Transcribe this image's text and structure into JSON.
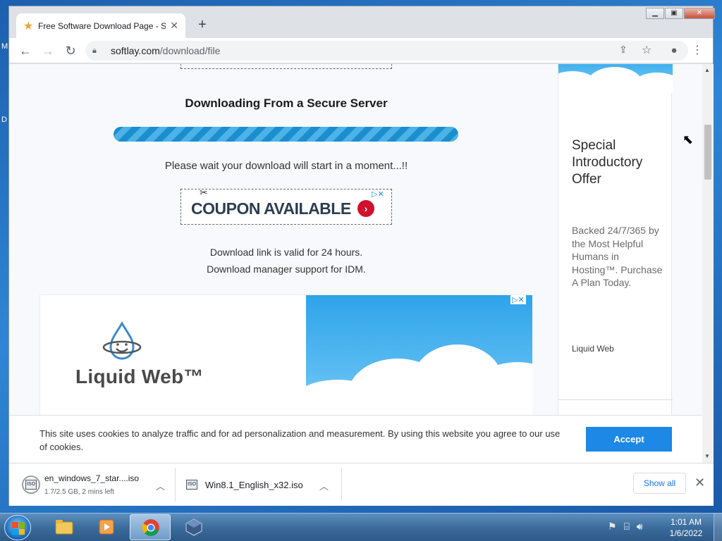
{
  "desktop": {
    "letters": [
      "M",
      "D"
    ]
  },
  "browser": {
    "tab_title": "Free Software Download Page - S",
    "new_tab_symbol": "+",
    "url_host": "softlay.com",
    "url_path": "/download/file"
  },
  "page": {
    "heading": "Downloading From a Secure Server",
    "wait_text": "Please wait your download will start in a moment...!!",
    "coupon_text": "COUPON AVAILABLE",
    "valid_line1": "Download link is valid for 24 hours.",
    "valid_line2": "Download manager support for IDM.",
    "ad_brand": "Liquid Web™"
  },
  "sidebar_ad": {
    "title": "Special Introductory Offer",
    "body": "Backed 24/7/365 by the Most Helpful Humans in Hosting™. Purchase A Plan Today.",
    "brand": "Liquid Web"
  },
  "cookie": {
    "text": "This site uses cookies to analyze traffic and for ad personalization and measurement. By using this website you agree to our use of cookies.",
    "accept_label": "Accept"
  },
  "downloads": {
    "items": [
      {
        "name": "en_windows_7_star....iso",
        "status": "1.7/2.5 GB, 2 mins left"
      },
      {
        "name": "Win8.1_English_x32.iso",
        "status": ""
      }
    ],
    "show_all_label": "Show all"
  },
  "taskbar": {
    "time": "1:01 AM",
    "date": "1/6/2022"
  },
  "colors": {
    "accent": "#1d88e5",
    "progress_stripe_a": "#4db2e8",
    "progress_stripe_b": "#1b8fce",
    "coupon_arrow": "#d0112b"
  },
  "icons": [
    "star-icon",
    "back-icon",
    "forward-icon",
    "reload-icon",
    "lock-icon",
    "share-icon",
    "bookmark-star-icon",
    "profile-icon",
    "menu-icon",
    "chevron-up-icon",
    "close-icon",
    "scissors-icon",
    "adchoices-icon"
  ]
}
